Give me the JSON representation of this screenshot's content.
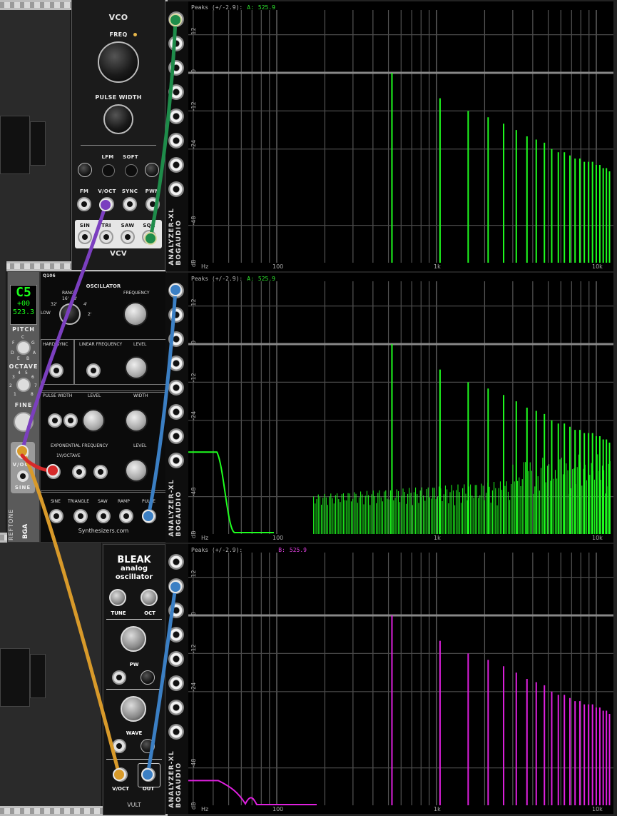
{
  "vco": {
    "title": "VCO",
    "freq": "FREQ",
    "pulse_width": "PULSE WIDTH",
    "lfm": "LFM",
    "soft": "SOFT",
    "fm": "FM",
    "voct": "V/OCT",
    "sync": "SYNC",
    "pwm": "PWM",
    "sin": "SIN",
    "tri": "TRI",
    "saw": "SAW",
    "sqr": "SQR",
    "brand": "VCV"
  },
  "reftone": {
    "note": "C5",
    "cents": "+00",
    "freq": "523.3",
    "pitch": "PITCH",
    "octave": "OCTAVE",
    "fine": "FINE",
    "pitch_notes": [
      "C",
      "F",
      "G",
      "D",
      "A",
      "E",
      "B"
    ],
    "octave_nums": [
      "3",
      "4",
      "5",
      "6",
      "7",
      "2",
      "1",
      "8"
    ],
    "voct": "V/OCT",
    "sine": "SINE",
    "brand": "REFTONE",
    "maker": "BGA"
  },
  "q106": {
    "model": "Q106",
    "title": "OSCILLATOR",
    "range": "RANGE",
    "low": "LOW",
    "r32": "32'",
    "r16": "16'",
    "r8": "8'",
    "r4": "4'",
    "r2": "2'",
    "frequency": "FREQUENCY",
    "hard_sync": "HARD SYNC",
    "linear_frequency": "LINEAR FREQUENCY",
    "level": "LEVEL",
    "pulse_width": "PULSE WIDTH",
    "width": "WIDTH",
    "exp_freq": "EXPONENTIAL FREQUENCY",
    "one_v_oct": "1V/OCTAVE",
    "sine": "SINE",
    "triangle": "TRIANGLE",
    "saw": "SAW",
    "ramp": "RAMP",
    "pulse": "PULSE",
    "brand": "Synthesizers.com"
  },
  "bleak": {
    "title": "BLEAK",
    "sub1": "analog",
    "sub2": "oscillator",
    "tune": "TUNE",
    "oct": "OCT",
    "pw": "PW",
    "wave": "WAVE",
    "voct": "V/OCT",
    "out": "OUT",
    "brand": "VULT"
  },
  "analyzer": {
    "name": "ANALYZER-XL",
    "maker": "BOGAUDIO",
    "db_labels": [
      "12",
      "0",
      "-12",
      "-24",
      "-48",
      "dB"
    ],
    "freq_labels": [
      "Hz",
      "100",
      "1k",
      "10k"
    ],
    "panels": [
      {
        "peaks_label": "Peaks (+/-2.9):",
        "channel": "A:",
        "value": "525.9",
        "color": "#1fff1f"
      },
      {
        "peaks_label": "Peaks (+/-2.9):",
        "channel": "A:",
        "value": "525.9",
        "color": "#1fff1f"
      },
      {
        "peaks_label": "Peaks (+/-2.9):",
        "channel": "B:",
        "value": "525.9",
        "color": "#e020e0"
      }
    ]
  },
  "cables": {
    "green": "#1e8c4a",
    "purple": "#7b3fbf",
    "blue": "#3b7fc4",
    "orange": "#d89a2a",
    "red": "#d62a2a"
  }
}
